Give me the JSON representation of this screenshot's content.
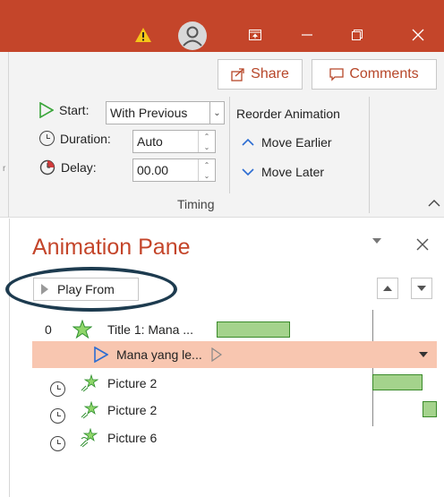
{
  "titlebar": {
    "warning_icon": "warning-triangle-icon",
    "avatar_icon": "user-avatar-icon",
    "ribbon_options_icon": "ribbon-display-options-icon",
    "minimize_icon": "minimize-icon",
    "restore_icon": "restore-icon",
    "close_icon": "close-icon",
    "accent": "#c4452a"
  },
  "ribbon": {
    "share_label": "Share",
    "comments_label": "Comments",
    "start_label": "Start:",
    "start_value": "With Previous",
    "duration_label": "Duration:",
    "duration_value": "Auto",
    "delay_label": "Delay:",
    "delay_value": "00.00",
    "reorder_label": "Reorder Animation",
    "move_earlier_label": "Move Earlier",
    "move_later_label": "Move Later",
    "group_label": "Timing"
  },
  "pane": {
    "title": "Animation Pane",
    "play_from_label": "Play From",
    "title_color": "#c4452a",
    "rows": [
      {
        "num": "0",
        "label": "Title 1: Mana ...",
        "icon": "emphasis-star-icon"
      },
      {
        "num": "",
        "label": "Mana yang le...",
        "icon": "play-trigger-icon"
      },
      {
        "num": "",
        "label": "Picture 2",
        "icon": "entrance-star-icon"
      },
      {
        "num": "",
        "label": "Picture 2",
        "icon": "entrance-star-icon"
      },
      {
        "num": "",
        "label": "Picture 6",
        "icon": "entrance-star-icon"
      }
    ]
  }
}
